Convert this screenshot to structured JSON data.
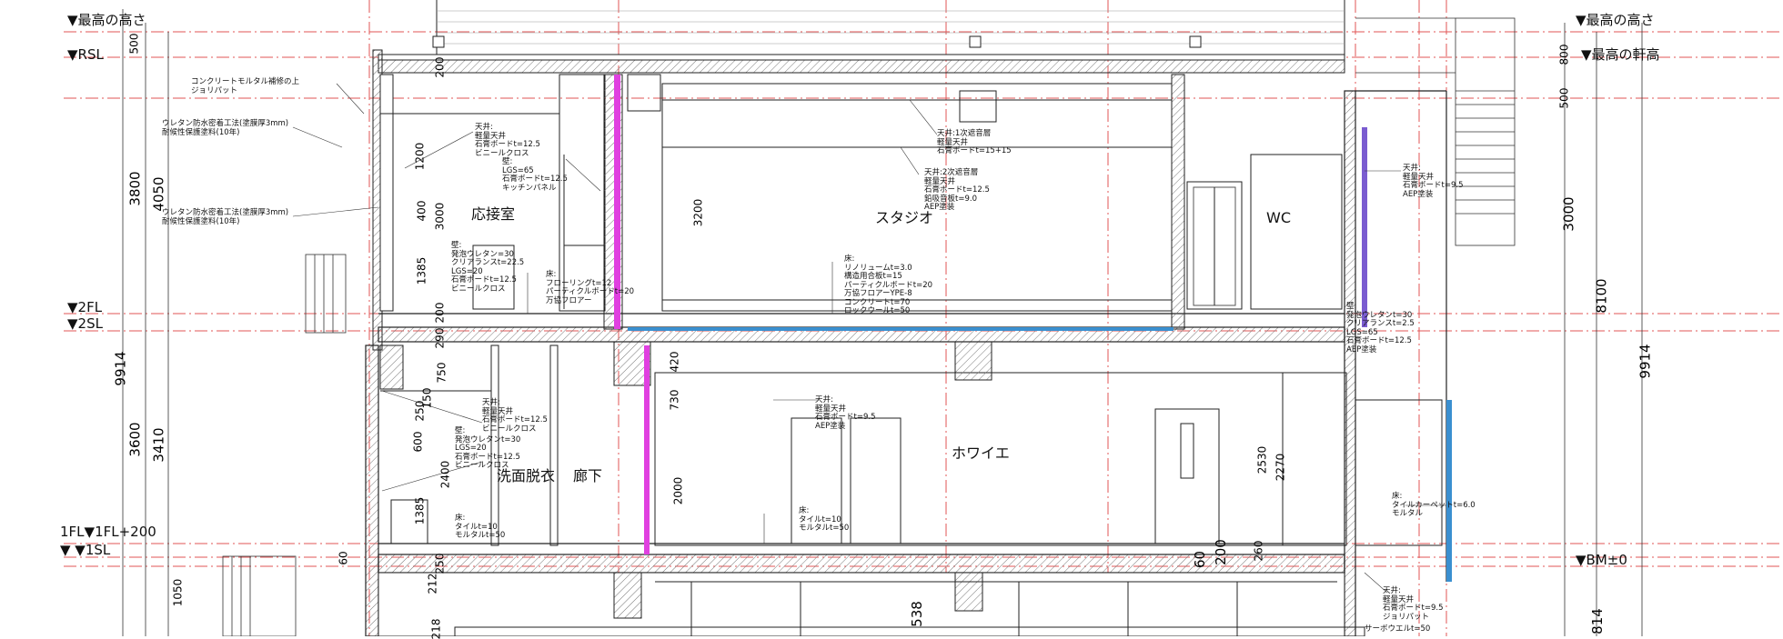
{
  "levels": {
    "max_height_left": "▼最高の高さ",
    "rsl": "▼RSL",
    "twofl": "▼2FL",
    "twosl": "▼2SL",
    "onefl": "1FL▼1FL+200",
    "onesl": "▼ ▼1SL",
    "max_height_right": "▼最高の高さ",
    "max_eaves": "▼最高の軒高",
    "bm": "▼BM±0"
  },
  "rooms": {
    "reception": "応接室",
    "studio": "スタジオ",
    "wc": "WC",
    "foyer": "ホワイエ",
    "washroom": "洗面脱衣",
    "corridor": "廊下"
  },
  "notes": {
    "mortar": [
      "コンクリートモルタル補修の上",
      "ジョリパット"
    ],
    "waterproof1": [
      "ウレタン防水密着工法(塗膜厚3mm)",
      "耐候性保護塗料(10年)"
    ],
    "waterproof2": [
      "ウレタン防水密着工法(塗膜厚3mm)",
      "耐候性保護塗料(10年)"
    ],
    "reception_ceiling": [
      "天井:",
      "軽量天井",
      "石膏ボードt=12.5",
      "ビニールクロス"
    ],
    "reception_wall_upper": [
      "壁:",
      "LGS=65",
      "石膏ボードt=12.5",
      "キッチンパネル"
    ],
    "reception_wall": [
      "壁:",
      "発泡ウレタン=30",
      "クリアランスt=22.5",
      "LGS=20",
      "石膏ボードt=12.5",
      "ビニールクロス"
    ],
    "reception_floor": [
      "床:",
      "フローリングt=12",
      "パーティクルボードt=20"
    ],
    "reception_floor_extra": "万協フロアー",
    "studio_ceiling1": [
      "天井:1次遮音層",
      "軽量天井",
      "石膏ボードt=15+15"
    ],
    "studio_ceiling2": [
      "天井:2次遮音層",
      "軽量天井",
      "石膏ボードt=12.5",
      "鉛吸音板t=9.0",
      "AEP塗装"
    ],
    "studio_floor": [
      "床:",
      "リノリュームt=3.0",
      "構造用合板t=15",
      "パーティクルボードt=20",
      "万協フロアーYPE-8",
      "コンクリートt=70",
      "ロックウールt=50"
    ],
    "wc_ceiling": [
      "天井:",
      "軽量天井",
      "石膏ボードt=9.5",
      "AEP塗装"
    ],
    "wc_wall": [
      "壁:",
      "発泡ウレタンt=30",
      "クリアランスt=2.5",
      "LGS=65",
      "石膏ボードt=12.5",
      "AEP塗装"
    ],
    "foyer_ceiling": [
      "天井:",
      "軽量天井",
      "石膏ボードt=9.5",
      "AEP塗装"
    ],
    "foyer_floor": [
      "床:",
      "タイルt=10",
      "モルタルt=50"
    ],
    "wash_ceiling": [
      "天井:",
      "軽量天井",
      "石膏ボードt=12.5",
      "ビニールクロス"
    ],
    "wash_wall": [
      "壁:",
      "発泡ウレタンt=30",
      "LGS=20",
      "石膏ボードt=12.5",
      "ビニールクロス"
    ],
    "wash_floor": [
      "床:",
      "タイルt=10",
      "モルタルt=50"
    ],
    "right_floor": [
      "床:",
      "タイルカーペットt=6.0",
      "モルタル"
    ],
    "basement_ceiling": [
      "天井:",
      "軽量天井",
      "石膏ボードt=9.5",
      "ジョリパット"
    ],
    "basement_bottom": "サーボウエルt=50"
  },
  "dims": {
    "d500": "500",
    "d200a": "200",
    "d1200": "1200",
    "d3800": "3800",
    "d4050": "4050",
    "d400": "400",
    "d3000a": "3000",
    "d1385a": "1385",
    "d200b": "200",
    "d290": "290",
    "d9914l": "9914",
    "d750": "750",
    "d250": "250",
    "d150": "150",
    "d600": "600",
    "d3600": "3600",
    "d3410": "3410",
    "d2400": "2400",
    "d1385b": "1385",
    "d60a": "60",
    "d1050": "1050",
    "d212": "212",
    "d2502": "250",
    "d218": "218",
    "d3200": "3200",
    "d420": "420",
    "d730": "730",
    "d2000": "2000",
    "d538": "538",
    "d2530": "2530",
    "d2270": "2270",
    "d60b": "60",
    "d200c": "200",
    "d260": "260",
    "d800": "800",
    "d500r": "500",
    "d3000r": "3000",
    "d8100": "8100",
    "d9914r": "9914",
    "d814": "814"
  },
  "colors": {
    "grid_red": "#e05555",
    "line": "#222222",
    "magenta": "#e040e0",
    "blue": "#3a8fd0",
    "purple": "#7a5cd0",
    "hatch": "#777777"
  }
}
